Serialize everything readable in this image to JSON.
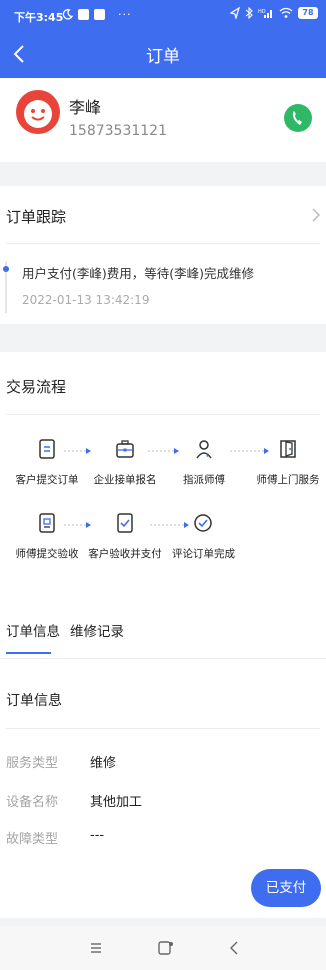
{
  "status_bar": {
    "time": "下午3:45",
    "battery": "78",
    "icons": [
      "moon-icon",
      "message-icon",
      "upload-icon",
      "more-icon",
      "location-icon",
      "bluetooth-icon",
      "hd-signal-icon",
      "wifi-icon",
      "battery-icon"
    ]
  },
  "nav": {
    "title": "订单",
    "back_icon": "chevron-left-icon"
  },
  "customer": {
    "name": "李峰",
    "phone": "15873531121",
    "call_icon": "phone-icon"
  },
  "tracking": {
    "title": "订单跟踪",
    "event_text": "用户支付(李峰)费用，等待(李峰)完成维修",
    "event_time": "2022-01-13 13:42:19"
  },
  "flow": {
    "title": "交易流程",
    "steps": [
      {
        "label": "客户提交订单",
        "icon": "document-icon"
      },
      {
        "label": "企业接单报名",
        "icon": "briefcase-icon"
      },
      {
        "label": "指派师傅",
        "icon": "person-icon"
      },
      {
        "label": "师傅上门服务",
        "icon": "door-icon"
      },
      {
        "label": "师傅提交验收",
        "icon": "id-card-icon"
      },
      {
        "label": "客户验收并支付",
        "icon": "checkbox-icon"
      },
      {
        "label": "评论订单完成",
        "icon": "check-circle-icon"
      }
    ]
  },
  "tabs": [
    {
      "label": "订单信息",
      "active": true
    },
    {
      "label": "维修记录",
      "active": false
    }
  ],
  "order_info": {
    "title": "订单信息",
    "rows": [
      {
        "label": "服务类型",
        "value": "维修"
      },
      {
        "label": "设备名称",
        "value": "其他加工"
      },
      {
        "label": "故障类型",
        "value": "---"
      }
    ]
  },
  "paid_button": "已支付",
  "bottom_nav": [
    "menu-icon",
    "home-icon",
    "back-icon"
  ],
  "colors": {
    "accent": "#3f6df0",
    "call_green": "#2fb866",
    "avatar_red": "#e8443a"
  }
}
